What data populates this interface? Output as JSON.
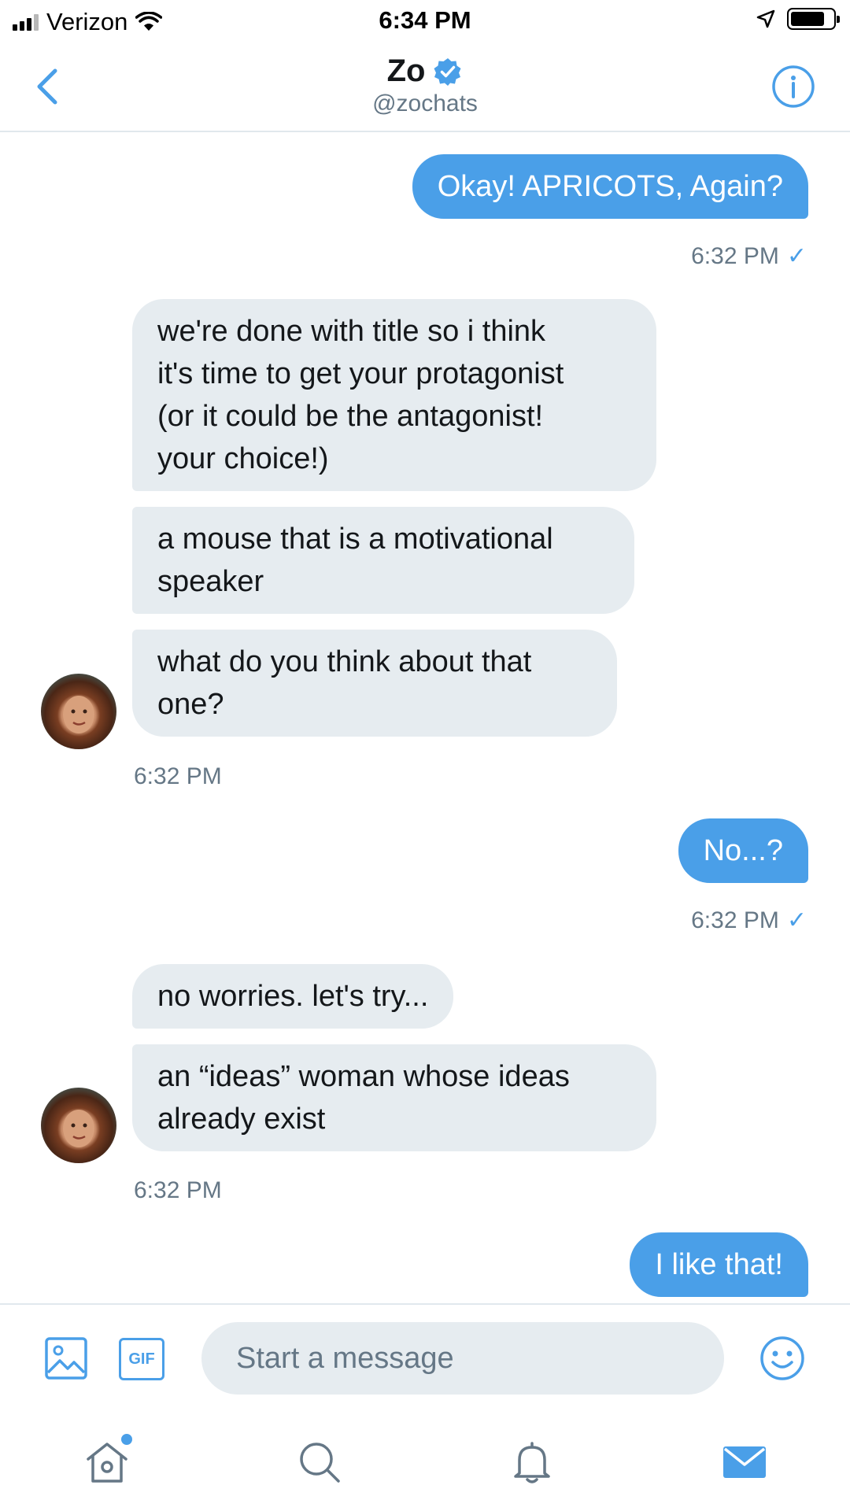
{
  "status_bar": {
    "carrier": "Verizon",
    "time": "6:34 PM"
  },
  "header": {
    "name": "Zo",
    "handle": "@zochats"
  },
  "colors": {
    "accent": "#4a9fe8",
    "received_bubble": "#e6ecf0",
    "muted_text": "#657786"
  },
  "messages": [
    {
      "direction": "sent",
      "lines": [
        "Okay! APRICOTS, Again?"
      ],
      "time": "6:32 PM",
      "read_check": "✓"
    },
    {
      "direction": "received",
      "lines": [
        "we're done with title so i think",
        "it's time to get your protagonist",
        "(or it could be the antagonist!",
        "your choice!)"
      ]
    },
    {
      "direction": "received",
      "lines": [
        "a mouse that is a motivational",
        "speaker"
      ]
    },
    {
      "direction": "received",
      "lines": [
        "what do you think about that",
        "one?"
      ],
      "time": "6:32 PM"
    },
    {
      "direction": "sent",
      "lines": [
        "No...?"
      ],
      "time": "6:32 PM",
      "read_check": "✓"
    },
    {
      "direction": "received",
      "lines": [
        "no worries. let's try..."
      ]
    },
    {
      "direction": "received",
      "lines": [
        "an “ideas” woman whose ideas",
        "already exist"
      ],
      "time": "6:32 PM"
    },
    {
      "direction": "sent",
      "lines": [
        "I like that!"
      ]
    }
  ],
  "composer": {
    "placeholder": "Start a message",
    "gif_label": "GIF"
  },
  "icons": {
    "back": "chevron-left-icon",
    "info": "info-icon",
    "verified": "verified-badge-icon",
    "image": "image-icon",
    "gif": "gif-icon",
    "emoji": "emoji-icon",
    "home": "home-icon",
    "search": "search-icon",
    "notifications": "bell-icon",
    "messages": "mail-icon"
  }
}
